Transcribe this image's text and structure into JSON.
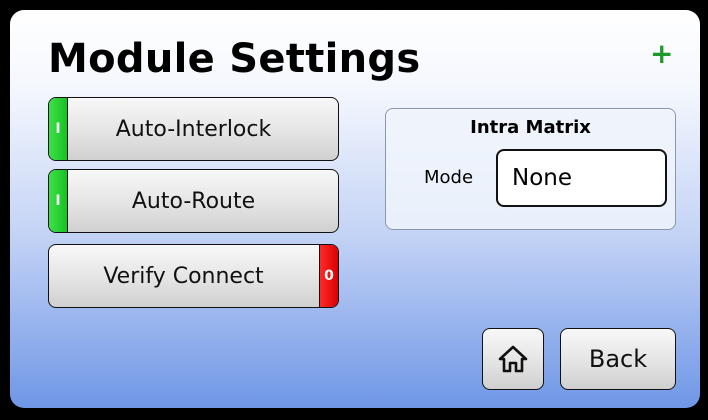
{
  "header": {
    "title": "Module Settings",
    "add_icon": "plus-icon",
    "add_symbol": "+"
  },
  "buttons": [
    {
      "label": "Auto-Interlock",
      "indicator": "I",
      "state": "on"
    },
    {
      "label": "Auto-Route",
      "indicator": "I",
      "state": "on"
    },
    {
      "label": "Verify Connect",
      "indicator": "0",
      "state": "off"
    }
  ],
  "intra_matrix": {
    "title": "Intra Matrix",
    "mode_label": "Mode",
    "mode_value": "None"
  },
  "footer": {
    "home_icon": "home-icon",
    "back_label": "Back"
  },
  "colors": {
    "on": "#16c222",
    "off": "#d90000",
    "accent": "#1f9a2a"
  }
}
